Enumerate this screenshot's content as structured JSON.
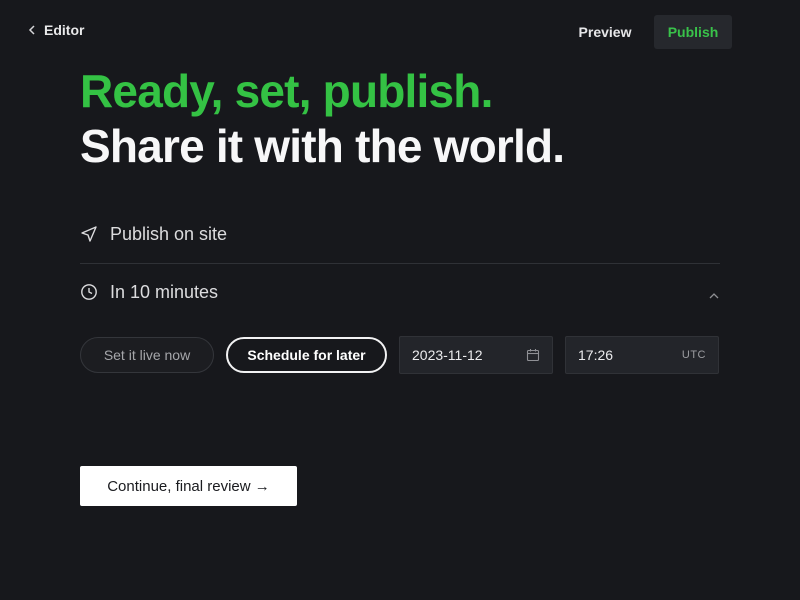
{
  "topbar": {
    "back_label": "Editor",
    "preview_label": "Preview",
    "publish_label": "Publish"
  },
  "headline": {
    "line1": "Ready, set, publish.",
    "line2": "Share it with the world."
  },
  "options": {
    "publish_on_site": "Publish on site",
    "schedule_summary": "In 10 minutes",
    "set_live_label": "Set it live now",
    "schedule_label": "Schedule for later",
    "selected": "Schedule for later",
    "date_value": "2023-11-12",
    "time_value": "17:26",
    "timezone": "UTC"
  },
  "footer": {
    "continue_label": "Continue, final review →"
  },
  "colors": {
    "background": "#17181c",
    "accent_green": "#34c244",
    "text_light": "#f7f7f8"
  },
  "icons": [
    "chevron-left-icon",
    "send-icon",
    "clock-icon",
    "chevron-up-icon",
    "calendar-icon"
  ]
}
